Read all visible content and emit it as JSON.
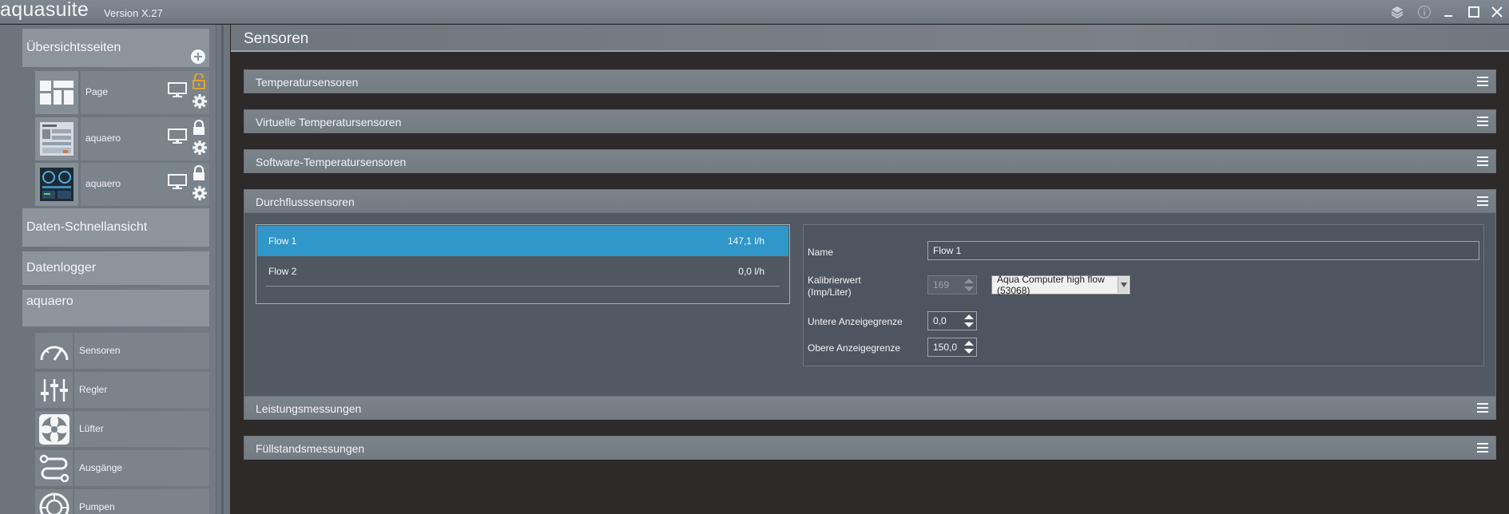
{
  "app": {
    "name": "aquasuite",
    "version": "Version X.27"
  },
  "window_controls": {
    "layers": "layers-icon",
    "info": "info-icon",
    "minimize": "minimize-icon",
    "maximize": "maximize-icon",
    "close": "close-icon"
  },
  "sidebar": {
    "overview": {
      "label": "Übersichtsseiten",
      "add_icon": "plus-circle-icon"
    },
    "pages": [
      {
        "label": "Page",
        "locked": false
      },
      {
        "label": "aquaero",
        "locked": true
      },
      {
        "label": "aquaero",
        "locked": true
      }
    ],
    "quick_view": "Daten-Schnellansicht",
    "datalogger": "Datenlogger",
    "device": "aquaero",
    "device_items": [
      {
        "label": "Sensoren",
        "icon": "gauge-icon"
      },
      {
        "label": "Regler",
        "icon": "sliders-icon"
      },
      {
        "label": "Lüfter",
        "icon": "fan-icon"
      },
      {
        "label": "Ausgänge",
        "icon": "outputs-icon"
      },
      {
        "label": "Pumpen",
        "icon": "pump-icon"
      }
    ]
  },
  "main": {
    "title": "Sensoren",
    "sections": [
      {
        "title": "Temperatursensoren"
      },
      {
        "title": "Virtuelle Temperatursensoren"
      },
      {
        "title": "Software-Temperatursensoren"
      },
      {
        "title": "Durchflusssensoren"
      },
      {
        "title": "Leistungsmessungen"
      },
      {
        "title": "Füllstandsmessungen"
      }
    ],
    "flow": {
      "list": [
        {
          "name": "Flow 1",
          "value": "147,1 l/h",
          "selected": true
        },
        {
          "name": "Flow 2",
          "value": "0,0 l/h",
          "selected": false
        }
      ],
      "details": {
        "name_label": "Name",
        "name_value": "Flow 1",
        "calib_label_1": "Kalibrierwert",
        "calib_label_2": "(Imp/Liter)",
        "calib_value": "169",
        "sensor_type": "Aqua Computer high flow (53068)",
        "lower_label": "Untere Anzeigegrenze",
        "lower_value": "0,0",
        "upper_label": "Obere Anzeigegrenze",
        "upper_value": "150,0"
      }
    }
  },
  "colors": {
    "accent_blue": "#2f97c9",
    "lock_gold": "#d9a53a",
    "background": "#2f2a2a"
  }
}
